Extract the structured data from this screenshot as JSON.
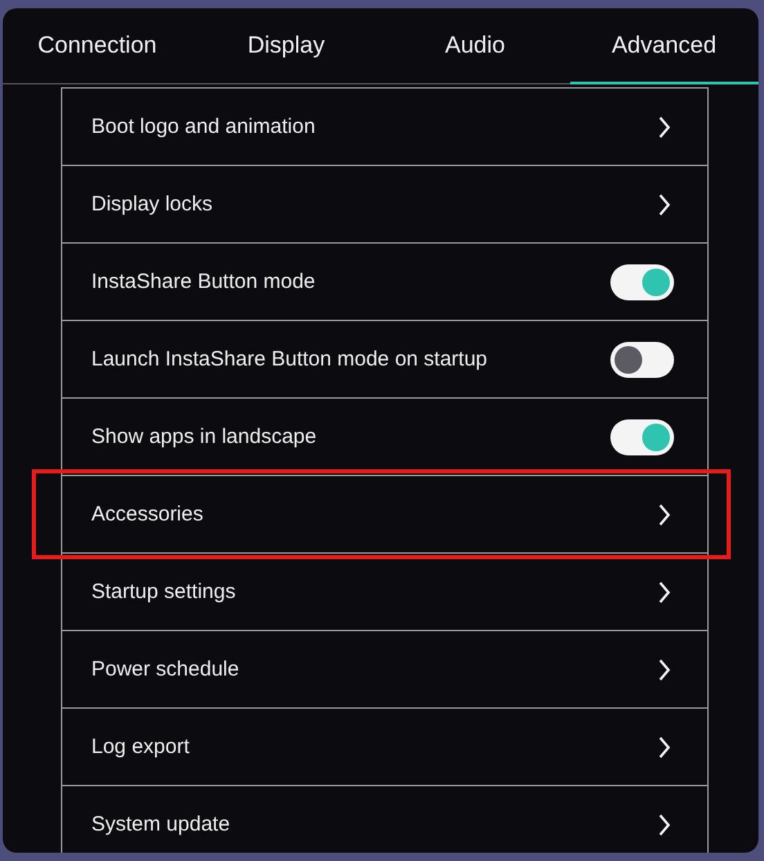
{
  "tabs": [
    {
      "label": "Connection",
      "selected": false
    },
    {
      "label": "Display",
      "selected": false
    },
    {
      "label": "Audio",
      "selected": false
    },
    {
      "label": "Advanced",
      "selected": true
    }
  ],
  "items": [
    {
      "label": "Boot logo and animation",
      "kind": "link",
      "highlighted": false
    },
    {
      "label": "Display locks",
      "kind": "link",
      "highlighted": false
    },
    {
      "label": "InstaShare Button mode",
      "kind": "toggle",
      "on": true,
      "highlighted": false
    },
    {
      "label": "Launch InstaShare Button mode on startup",
      "kind": "toggle",
      "on": false,
      "highlighted": false
    },
    {
      "label": "Show apps in landscape",
      "kind": "toggle",
      "on": true,
      "highlighted": false
    },
    {
      "label": "Accessories",
      "kind": "link",
      "highlighted": true
    },
    {
      "label": "Startup settings",
      "kind": "link",
      "highlighted": false
    },
    {
      "label": "Power schedule",
      "kind": "link",
      "highlighted": false
    },
    {
      "label": "Log export",
      "kind": "link",
      "highlighted": false
    },
    {
      "label": "System update",
      "kind": "link",
      "highlighted": false
    }
  ]
}
